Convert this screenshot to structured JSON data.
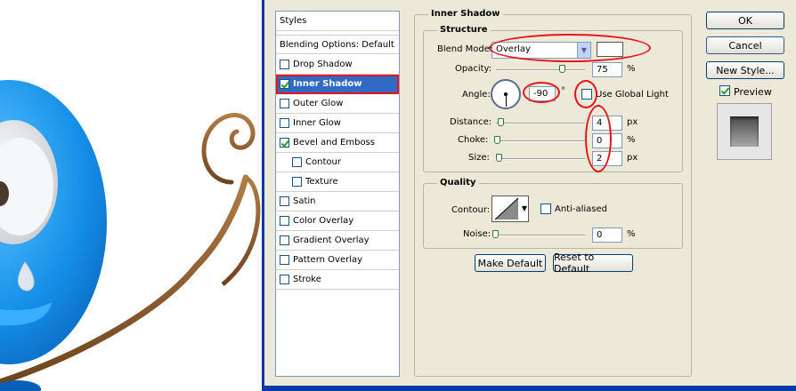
{
  "styles_list": {
    "header": "Styles",
    "blending_options": "Blending Options: Default",
    "items": [
      {
        "label": "Drop Shadow",
        "checked": false,
        "indent": false,
        "selected": false
      },
      {
        "label": "Inner Shadow",
        "checked": true,
        "indent": false,
        "selected": true
      },
      {
        "label": "Outer Glow",
        "checked": false,
        "indent": false,
        "selected": false
      },
      {
        "label": "Inner Glow",
        "checked": false,
        "indent": false,
        "selected": false
      },
      {
        "label": "Bevel and Emboss",
        "checked": true,
        "indent": false,
        "selected": false
      },
      {
        "label": "Contour",
        "checked": false,
        "indent": true,
        "selected": false
      },
      {
        "label": "Texture",
        "checked": false,
        "indent": true,
        "selected": false
      },
      {
        "label": "Satin",
        "checked": false,
        "indent": false,
        "selected": false
      },
      {
        "label": "Color Overlay",
        "checked": false,
        "indent": false,
        "selected": false
      },
      {
        "label": "Gradient Overlay",
        "checked": false,
        "indent": false,
        "selected": false
      },
      {
        "label": "Pattern Overlay",
        "checked": false,
        "indent": false,
        "selected": false
      },
      {
        "label": "Stroke",
        "checked": false,
        "indent": false,
        "selected": false
      }
    ]
  },
  "inner_shadow": {
    "title": "Inner Shadow",
    "structure": {
      "title": "Structure",
      "blend_mode_label": "Blend Mode:",
      "blend_mode_value": "Overlay",
      "opacity_label": "Opacity:",
      "opacity_value": "75",
      "opacity_unit": "%",
      "opacity_fraction": 0.75,
      "angle_label": "Angle:",
      "angle_value": "-90",
      "angle_unit": "°",
      "use_global_light_label": "Use Global Light",
      "use_global_light_checked": false,
      "distance_label": "Distance:",
      "distance_value": "4",
      "distance_unit": "px",
      "choke_label": "Choke:",
      "choke_value": "0",
      "choke_unit": "%",
      "size_label": "Size:",
      "size_value": "2",
      "size_unit": "px"
    },
    "quality": {
      "title": "Quality",
      "contour_label": "Contour:",
      "anti_aliased_label": "Anti-aliased",
      "anti_aliased_checked": false,
      "noise_label": "Noise:",
      "noise_value": "0",
      "noise_unit": "%"
    },
    "make_default_label": "Make Default",
    "reset_default_label": "Reset to Default"
  },
  "actions": {
    "ok_label": "OK",
    "cancel_label": "Cancel",
    "new_style_label": "New Style...",
    "preview_label": "Preview",
    "preview_checked": true
  },
  "colors": {
    "dialog_bg": "#ece9d8",
    "selection": "#316ac5",
    "annotation_red": "#e8141c",
    "character_blue": "#1a8fe0",
    "vine_brown": "#8a5a2b"
  }
}
